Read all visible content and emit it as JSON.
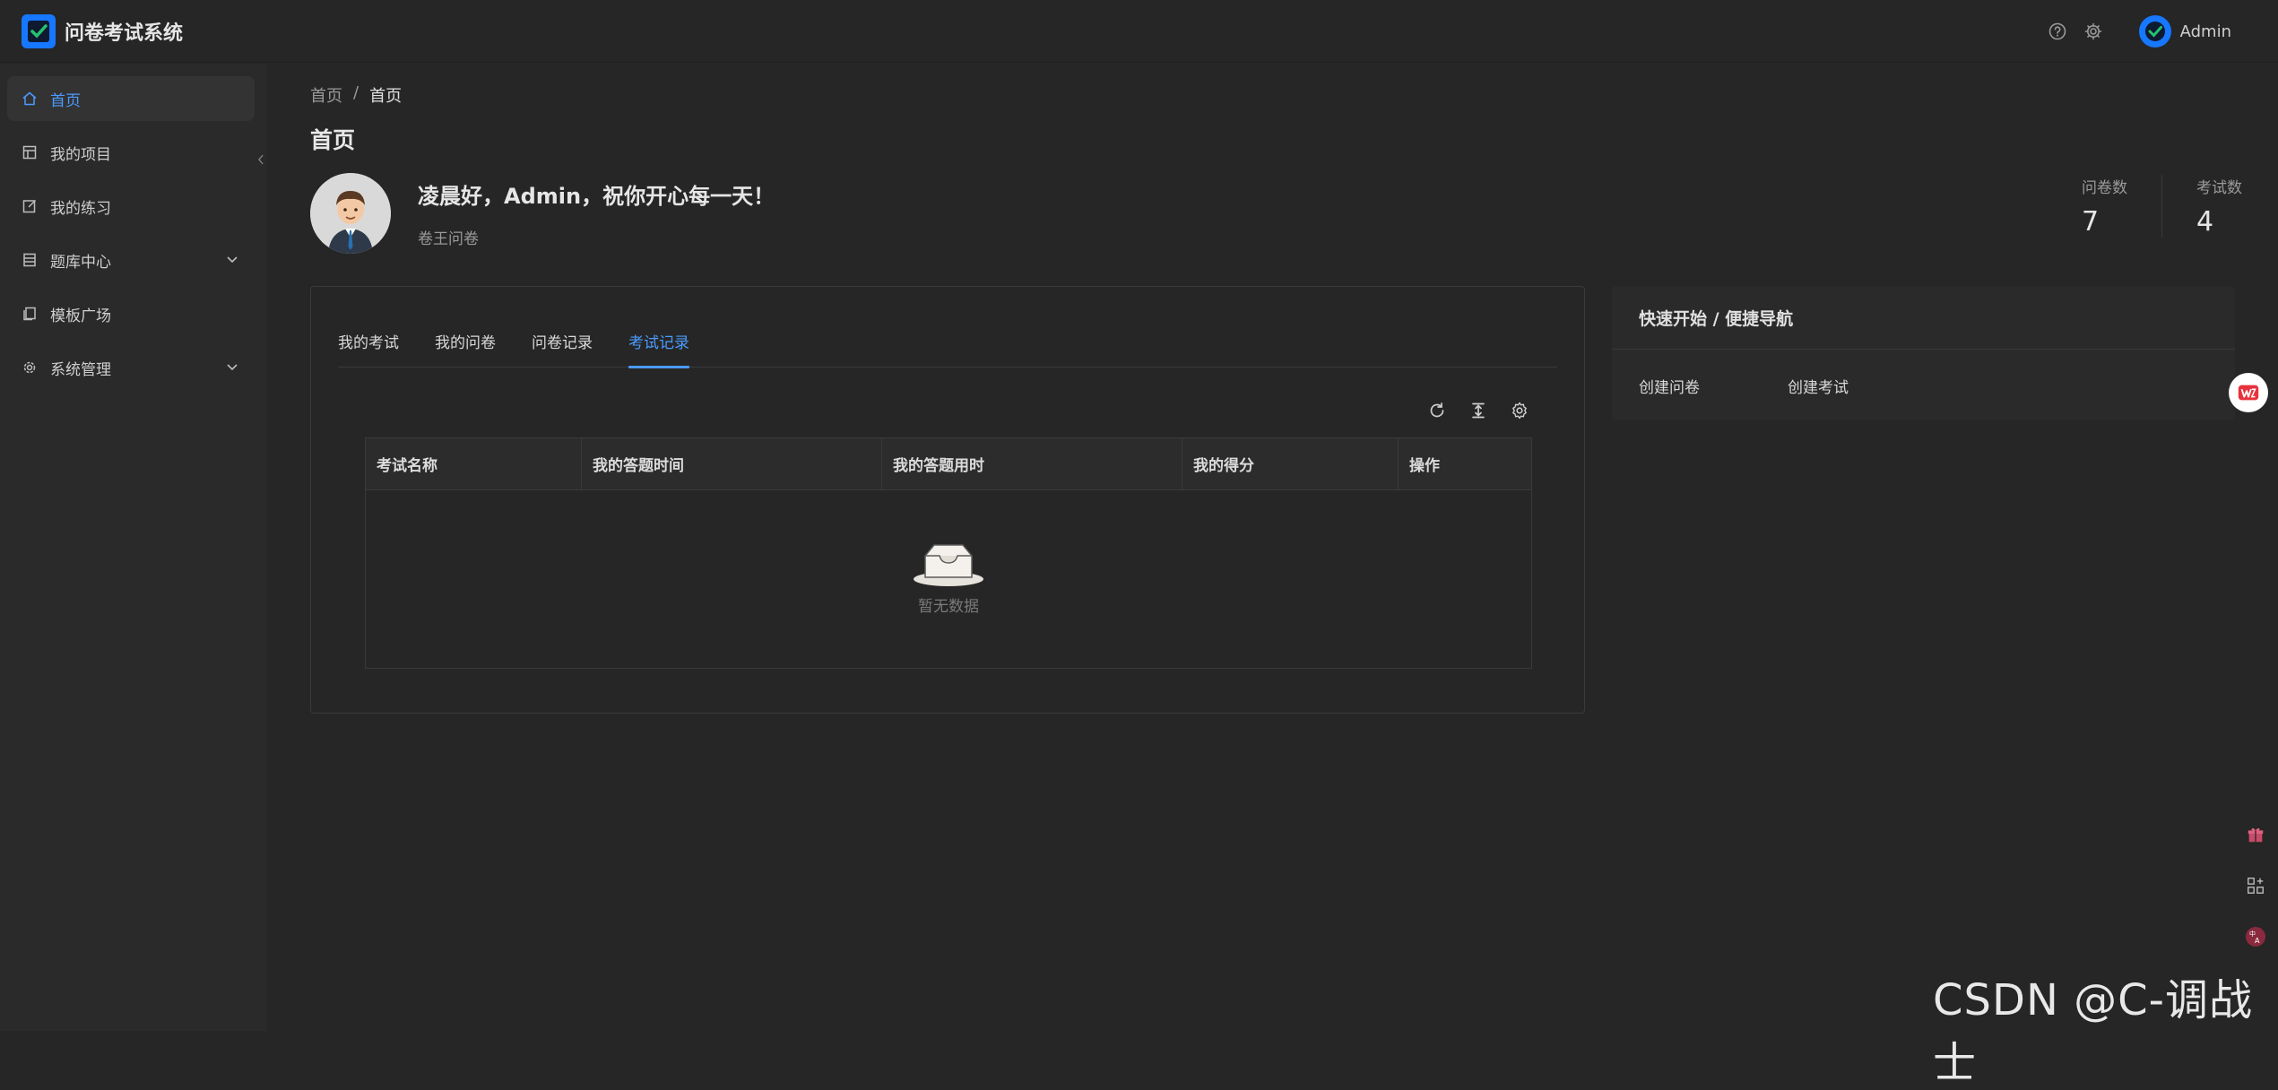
{
  "app": {
    "title": "问卷考试系统"
  },
  "header": {
    "username": "Admin",
    "icons": [
      "help-icon",
      "gear-icon"
    ]
  },
  "sidebar": {
    "items": [
      {
        "label": "首页",
        "icon": "home-icon",
        "active": true
      },
      {
        "label": "我的项目",
        "icon": "project-icon"
      },
      {
        "label": "我的练习",
        "icon": "edit-icon"
      },
      {
        "label": "题库中心",
        "icon": "book-icon",
        "expandable": true
      },
      {
        "label": "模板广场",
        "icon": "copy-icon"
      },
      {
        "label": "系统管理",
        "icon": "gear-icon",
        "expandable": true
      }
    ]
  },
  "breadcrumb": {
    "home": "首页",
    "separator": "/",
    "current": "首页"
  },
  "page": {
    "title": "首页"
  },
  "profile": {
    "greeting": "凌晨好，Admin，祝你开心每一天！",
    "subtitle": "卷王问卷"
  },
  "stats": [
    {
      "label": "问卷数",
      "value": "7"
    },
    {
      "label": "考试数",
      "value": "4"
    }
  ],
  "tabs": [
    {
      "label": "我的考试"
    },
    {
      "label": "我的问卷"
    },
    {
      "label": "问卷记录"
    },
    {
      "label": "考试记录",
      "active": true
    }
  ],
  "table": {
    "columns": [
      "考试名称",
      "我的答题时间",
      "我的答题用时",
      "我的得分",
      "操作"
    ],
    "empty_text": "暂无数据"
  },
  "quick_nav": {
    "title": "快速开始 / 便捷导航",
    "links": [
      "创建问卷",
      "创建考试"
    ]
  },
  "watermark": "CSDN @C-调战士",
  "colors": {
    "accent": "#4a9bff",
    "brand": "#1677ff",
    "background": "#262626"
  }
}
